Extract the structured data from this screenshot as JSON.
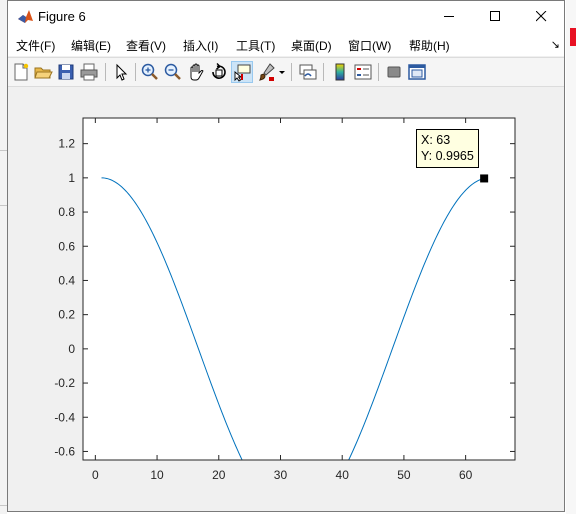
{
  "window": {
    "title": "Figure 6",
    "controls": {
      "minimize": "minimize-icon",
      "maximize": "maximize-icon",
      "close": "close-icon"
    }
  },
  "menu": [
    {
      "label": "文件(F)"
    },
    {
      "label": "编辑(E)"
    },
    {
      "label": "查看(V)"
    },
    {
      "label": "插入(I)"
    },
    {
      "label": "工具(T)"
    },
    {
      "label": "桌面(D)"
    },
    {
      "label": "窗口(W)"
    },
    {
      "label": "帮助(H)"
    }
  ],
  "menu_overflow": "↘",
  "toolbar": [
    "new-figure-icon",
    "open-file-icon",
    "save-icon",
    "print-icon",
    "edit-plot-icon",
    "zoom-in-icon",
    "zoom-out-icon",
    "pan-icon",
    "rotate-3d-icon",
    "data-cursor-icon",
    "brush-icon",
    "brush-dropdown-icon",
    "link-plot-icon",
    "colorbar-icon",
    "legend-icon",
    "hide-plot-tools-icon",
    "show-plot-tools-icon"
  ],
  "datatip": {
    "x_text": "X: 63",
    "y_text": "Y: 0.9965"
  },
  "chart_data": {
    "type": "line",
    "title": "",
    "xlabel": "",
    "ylabel": "",
    "xlim": [
      -2,
      68
    ],
    "ylim": [
      -0.65,
      1.35
    ],
    "xticks": [
      0,
      10,
      20,
      30,
      40,
      50,
      60
    ],
    "xtick_labels": [
      "0",
      "10",
      "20",
      "30",
      "40",
      "50",
      "60"
    ],
    "yticks": [
      -0.6,
      -0.4,
      -0.2,
      0,
      0.2,
      0.4,
      0.6,
      0.8,
      1,
      1.2
    ],
    "ytick_labels": [
      "-0.6",
      "-0.4",
      "-0.2",
      "0",
      "0.2",
      "0.4",
      "0.6",
      "0.8",
      "1",
      "1.2"
    ],
    "series": [
      {
        "color": "#0072bd",
        "x_start": 1,
        "x_end": 63,
        "formula": "y = cos((x - 1) * 0.1)"
      }
    ],
    "marker": {
      "x": 63,
      "y": 0.9965
    },
    "grid": false
  }
}
